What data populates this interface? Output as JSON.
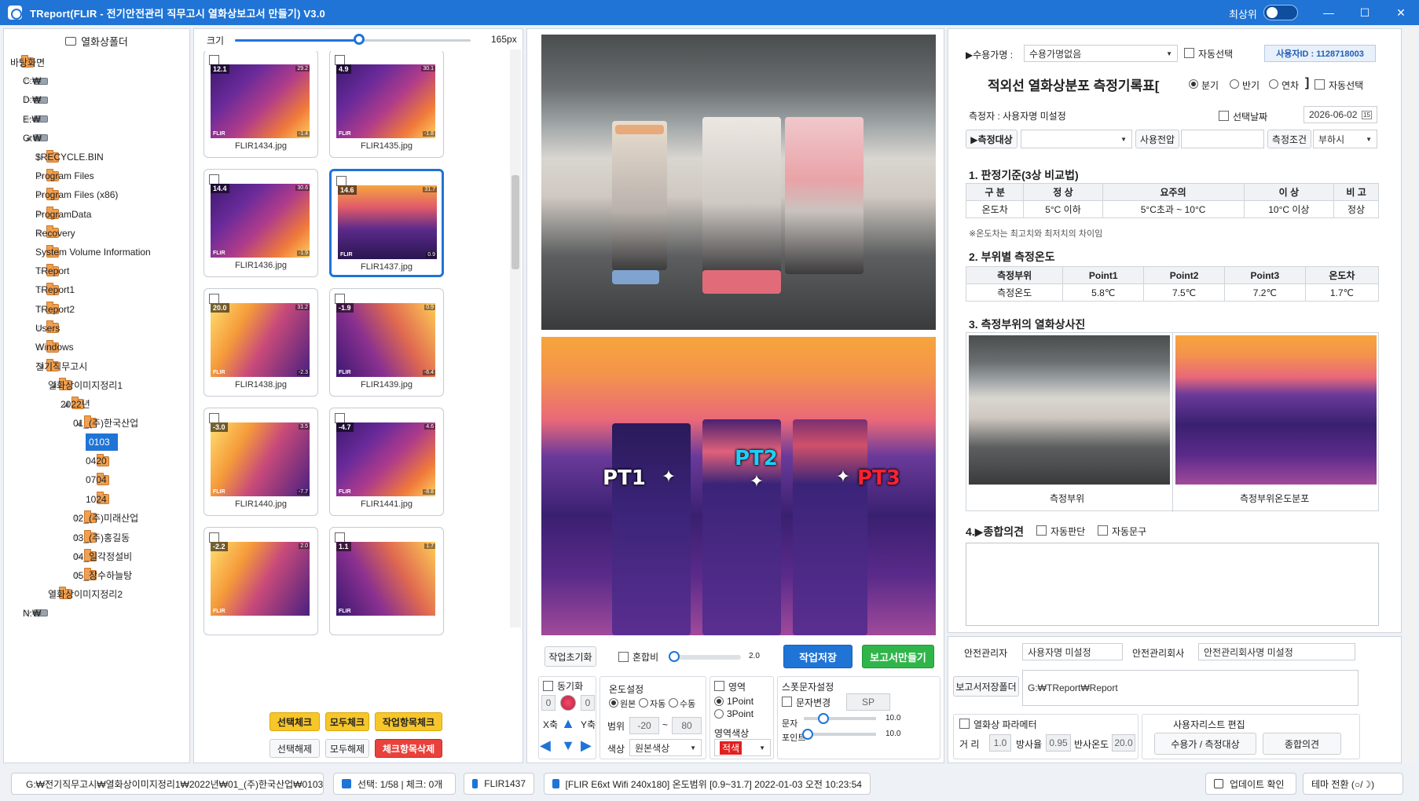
{
  "window": {
    "title": "TReport(FLIR - 전기안전관리 직무고시 열화상보고서 만들기) V3.0",
    "topmost_label": "최상위",
    "min": "—",
    "max": "☐",
    "close": "✕"
  },
  "tree": {
    "header": "열화상폴더",
    "items": [
      {
        "label": "바탕화면",
        "type": "folder"
      },
      {
        "label": "C:₩",
        "type": "drive"
      },
      {
        "label": "D:₩",
        "type": "drive"
      },
      {
        "label": "E:₩",
        "type": "drive"
      },
      {
        "label": "G:₩",
        "type": "drive"
      },
      {
        "label": "$RECYCLE.BIN",
        "type": "folder"
      },
      {
        "label": "Program Files",
        "type": "folder"
      },
      {
        "label": "Program Files (x86)",
        "type": "folder"
      },
      {
        "label": "ProgramData",
        "type": "folder"
      },
      {
        "label": "Recovery",
        "type": "folder"
      },
      {
        "label": "System Volume Information",
        "type": "folder"
      },
      {
        "label": "TReport",
        "type": "folder"
      },
      {
        "label": "TReport1",
        "type": "folder"
      },
      {
        "label": "TReport2",
        "type": "folder"
      },
      {
        "label": "Users",
        "type": "folder"
      },
      {
        "label": "Windows",
        "type": "folder"
      },
      {
        "label": "전기직무고시",
        "type": "folder"
      },
      {
        "label": "열화상이미지정리1",
        "type": "folder"
      },
      {
        "label": "2022년",
        "type": "folder"
      },
      {
        "label": "01_(주)한국산업",
        "type": "folder"
      },
      {
        "label": "0103",
        "type": "folder"
      },
      {
        "label": "0420",
        "type": "folder"
      },
      {
        "label": "0704",
        "type": "folder"
      },
      {
        "label": "1024",
        "type": "folder"
      },
      {
        "label": "02_(주)미래산업",
        "type": "folder"
      },
      {
        "label": "03_(주)홍길동",
        "type": "folder"
      },
      {
        "label": "04_일각정설비",
        "type": "folder"
      },
      {
        "label": "05_장수하늘탕",
        "type": "folder"
      },
      {
        "label": "열화상이미지정리2",
        "type": "folder"
      },
      {
        "label": "N:₩",
        "type": "drive"
      }
    ]
  },
  "thumbs": {
    "size_label": "크기",
    "size_value": "165px",
    "size_fraction": 0.53,
    "items": [
      {
        "name": "FLIR1434.jpg",
        "max": "29.2",
        "min": "-1.4",
        "temp": "12.1"
      },
      {
        "name": "FLIR1435.jpg",
        "max": "30.1",
        "min": "-1.8",
        "temp": "4.9"
      },
      {
        "name": "FLIR1436.jpg",
        "max": "30.6",
        "min": "-1.9",
        "temp": "14.4"
      },
      {
        "name": "FLIR1437.jpg",
        "max": "31.7",
        "min": "0.9",
        "temp": "14.6"
      },
      {
        "name": "FLIR1438.jpg",
        "max": "31.2",
        "min": "-2.3",
        "temp": "20.0"
      },
      {
        "name": "FLIR1439.jpg",
        "max": "0.9",
        "min": "-6.4",
        "temp": "-1.9"
      },
      {
        "name": "FLIR1440.jpg",
        "max": "3.5",
        "min": "-7.7",
        "temp": "-3.0"
      },
      {
        "name": "FLIR1441.jpg",
        "max": "4.6",
        "min": "-8.8",
        "temp": "-4.7"
      },
      {
        "name": "",
        "max": "2.0",
        "min": "",
        "temp": "-2.2"
      },
      {
        "name": "",
        "max": "1.7",
        "min": "",
        "temp": "1.1"
      }
    ],
    "flir_logo": "FLIR",
    "buttons": {
      "check_select": "선택체크",
      "check_all": "모두체크",
      "check_done": "작업항목체크",
      "uncheck_select": "선택해제",
      "uncheck_all": "모두해제",
      "delete_checked": "체크항목삭제"
    }
  },
  "viewer": {
    "pt1": "PT1",
    "pt2": "PT2",
    "pt3": "PT3",
    "reset": "작업초기화",
    "blend": "혼합비",
    "blend_value": "2.0",
    "save": "작업저장",
    "make_report": "보고서만들기",
    "sync": "동기화",
    "sync_left": "0",
    "sync_right": "0",
    "x_axis": "X축",
    "y_axis": "Y축",
    "temp_setting": "온도설정",
    "temp_orig": "원본",
    "temp_auto": "자동",
    "temp_manual": "수동",
    "range": "범위",
    "range_min": "-20",
    "range_sep": "~",
    "range_max": "80",
    "color": "색상",
    "color_value": "원본색상",
    "area": "영역",
    "area_1p": "1Point",
    "area_3p": "3Point",
    "area_color": "영역색상",
    "area_color_value": "적색",
    "spot_setting": "스폿문자설정",
    "char_change": "문자변경",
    "sp": "SP",
    "char": "문자",
    "char_value": "10.0",
    "point": "포인트",
    "point_value": "10.0"
  },
  "report": {
    "customer_label": "▶수용가명 :",
    "customer_value": "수용가명없음",
    "auto_select": "자동선택",
    "user_id": "사용자ID : 1128718003",
    "title": "적외선 열화상분포 측정기록표[",
    "period_quarter": "분기",
    "period_half": "반기",
    "period_year": "연차",
    "title_end": "]",
    "auto_select2": "자동선택",
    "measurer": "측정자 : 사용자명 미설정",
    "select_date": "선택날짜",
    "date_value": "2026-06-02",
    "cal_icon": "15",
    "target_label": "▶측정대상",
    "voltage_label": "사용전압",
    "cond_label": "측정조건",
    "cond_value": "부하시",
    "sec1": "1. 판정기준(3상 비교법)",
    "crit_header": [
      "구 분",
      "정 상",
      "요주의",
      "이 상",
      "비 고"
    ],
    "crit_row": [
      "온도차",
      "5°C 이하",
      "5°C초과 ~ 10°C",
      "10°C 이상",
      "정상"
    ],
    "note": "※온도차는 최고치와 최저치의 차이임",
    "sec2": "2. 부위별 측정온도",
    "meas_header": [
      "측정부위",
      "Point1",
      "Point2",
      "Point3",
      "온도차"
    ],
    "meas_row": [
      "측정온도",
      "5.8℃",
      "7.5℃",
      "7.2℃",
      "1.7℃"
    ],
    "sec3": "3. 측정부위의 열화상사진",
    "photo1_cap": "측정부위",
    "photo2_cap": "측정부위온도분포",
    "sec4": "4.▶종합의견",
    "auto_judge": "자동판단",
    "auto_text": "자동문구"
  },
  "footer": {
    "safety_manager_label": "안전관리자",
    "safety_manager_value": "사용자명 미설정",
    "safety_company_label": "안전관리회사",
    "safety_company_value": "안전관리회사명 미설정",
    "report_folder_btn": "보고서저장폴더",
    "report_folder_value": "G:₩TReport₩Report",
    "param_title": "열화상 파라메터",
    "dist_label": "거  리",
    "dist_value": "1.0",
    "emis_label": "방사율",
    "emis_value": "0.95",
    "refl_label": "반사온도",
    "refl_value": "20.0",
    "userlist_title": "사용자리스트 편집",
    "customer_target_btn": "수용가 / 측정대상",
    "opinion_btn": "종합의견"
  },
  "status": {
    "path": "G:₩전기직무고시₩열화상이미지정리1₩2022년₩01_(주)한국산업₩0103",
    "selection": "선택: 1/58 | 체크: 0개",
    "file": "FLIR1437",
    "info": "[FLIR E6xt Wifi 240x180] 온도범위 [0.9~31.7] 2022-01-03 오전 10:23:54",
    "update": "업데이트 확인",
    "theme": "테마 전환 (○/☽)"
  }
}
